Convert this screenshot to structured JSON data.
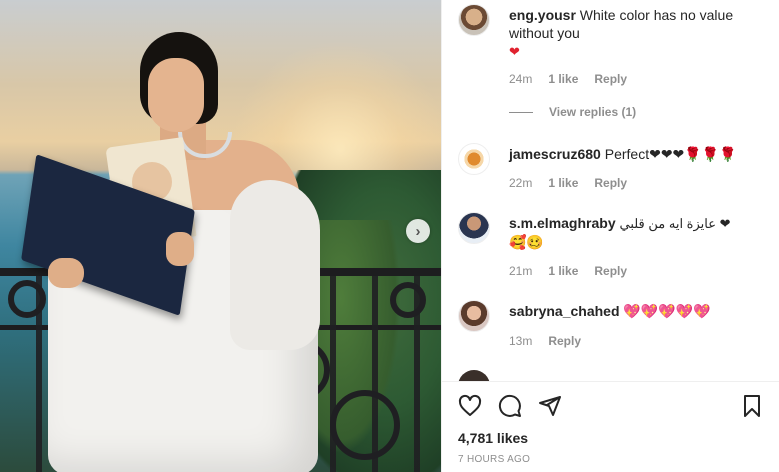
{
  "post": {
    "likes": "4,781 likes",
    "timestamp": "7 HOURS AGO"
  },
  "comments": [
    {
      "user": "eng.yousr",
      "text": "White color has no value without you",
      "emoji": "❤",
      "age": "24m",
      "likes": "1 like",
      "reply": "Reply",
      "view_replies": "View replies (1)"
    },
    {
      "user": "jamescruz680",
      "text": "Perfect❤❤❤🌹🌹🌹",
      "age": "22m",
      "likes": "1 like",
      "reply": "Reply"
    },
    {
      "user": "s.m.elmaghraby",
      "text": "عايزة ايه من قلبي ❤",
      "emoji": "🥰🥴",
      "age": "21m",
      "likes": "1 like",
      "reply": "Reply"
    },
    {
      "user": "sabryna_chahed",
      "text": "💖💖💖💖💖",
      "age": "13m",
      "reply": "Reply"
    }
  ],
  "icons": {
    "like": "heart-icon",
    "comment": "comment-icon",
    "share": "paper-plane-icon",
    "save": "bookmark-icon",
    "next": "chevron-right-icon"
  },
  "colors": {
    "text": "#262626",
    "muted": "#8e8e8e",
    "heart": "#e0222f"
  }
}
